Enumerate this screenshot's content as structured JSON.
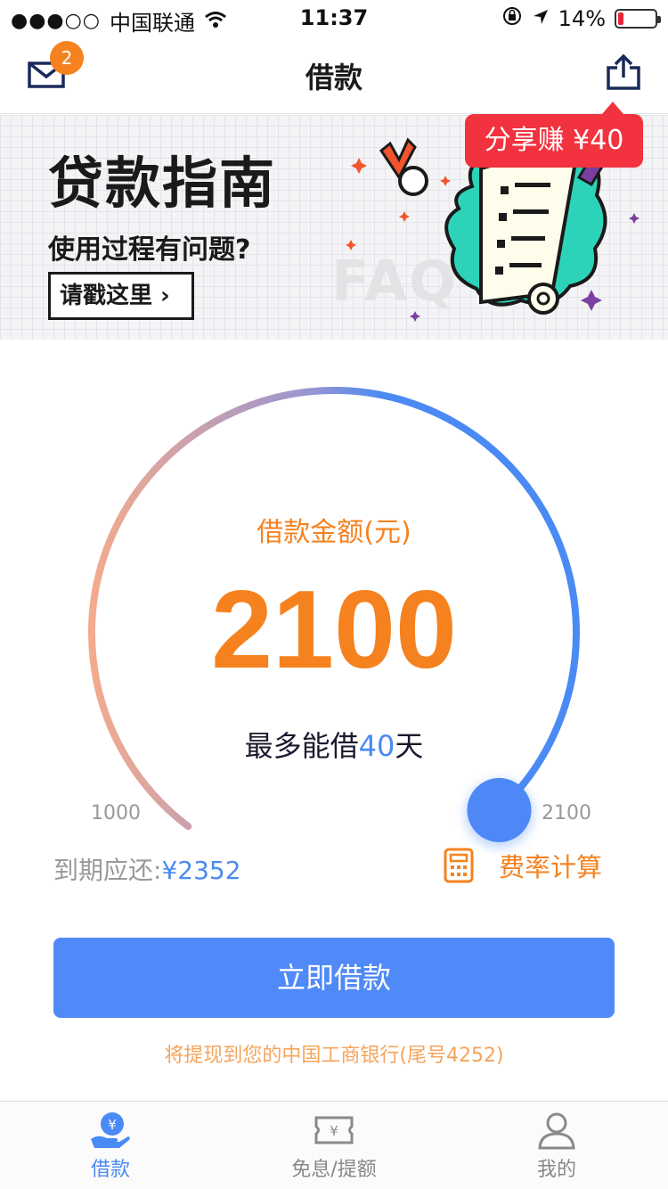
{
  "status_bar": {
    "carrier": "中国联通",
    "signal": "●●●○○",
    "time": "11:37",
    "battery": "14%",
    "battery_level": 0.14
  },
  "nav": {
    "title": "借款",
    "mail_badge": "2"
  },
  "banner": {
    "title": "贷款指南",
    "subtitle": "使用过程有问题?",
    "button_label": "请戳这里 ›",
    "faq": "FAQ"
  },
  "share_tag": "分享赚 ¥40",
  "loan": {
    "amount_label": "借款金额(元)",
    "amount": "2100",
    "days_prefix": "最多能借",
    "days": "40",
    "days_suffix": "天",
    "min": "1000",
    "max": "2100",
    "slider_fraction": 1.0,
    "repay_label": "到期应还:",
    "repay_value": "¥2352",
    "rate_calc_label": "费率计算",
    "borrow_button": "立即借款",
    "bank_note": "将提现到您的中国工商银行(尾号4252)"
  },
  "tabs": [
    {
      "label": "借款",
      "icon": "loan-hand-icon",
      "active": true
    },
    {
      "label": "免息/提额",
      "icon": "coupon-icon",
      "active": false
    },
    {
      "label": "我的",
      "icon": "profile-icon",
      "active": false
    }
  ],
  "colors": {
    "accent_orange": "#f5821f",
    "accent_blue": "#508af8",
    "share_red": "#f2323e",
    "arc_start": "#f3ab8d",
    "arc_end": "#4a8af4"
  }
}
